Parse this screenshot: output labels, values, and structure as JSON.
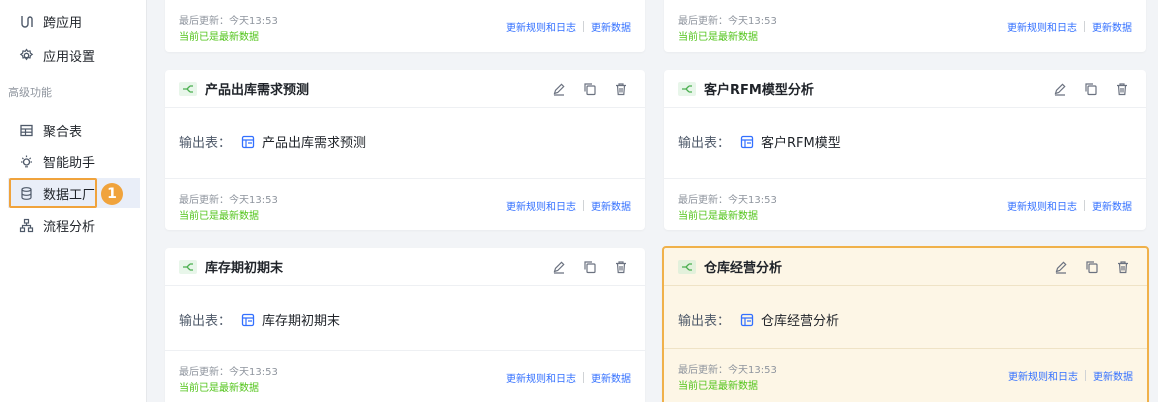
{
  "sidebar": {
    "items_top": [
      {
        "label": "跨应用",
        "icon": "cross-app-icon"
      },
      {
        "label": "应用设置",
        "icon": "gear-icon"
      }
    ],
    "group_label": "高级功能",
    "items_adv": [
      {
        "label": "聚合表",
        "icon": "table-grid-icon"
      },
      {
        "label": "智能助手",
        "icon": "bulb-icon"
      },
      {
        "label": "数据工厂",
        "icon": "database-icon",
        "active": true
      },
      {
        "label": "流程分析",
        "icon": "flow-tree-icon"
      }
    ],
    "step_badge": "1"
  },
  "common": {
    "output_label": "输出表：",
    "last_update": "最后更新：今天13:53",
    "up_to_date": "当前已是最新数据",
    "rules_log": "更新规则和日志",
    "update_data": "更新数据"
  },
  "cards": [
    {
      "title": "产品出库需求预测",
      "output_table": "产品出库需求预测"
    },
    {
      "title": "客户RFM模型分析",
      "output_table": "客户RFM模型"
    },
    {
      "title": "库存期初期末",
      "output_table": "库存期初期末"
    },
    {
      "title": "仓库经营分析",
      "output_table": "仓库经营分析",
      "highlighted": true
    }
  ],
  "colors": {
    "accent": "#3370ff",
    "success": "#52c41a",
    "highlight": "#f0a33c"
  }
}
